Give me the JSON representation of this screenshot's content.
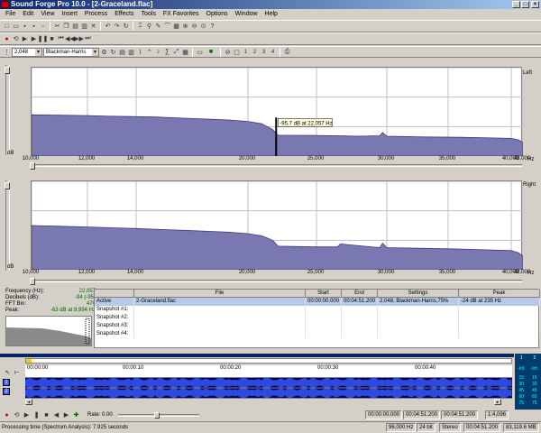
{
  "titlebar": {
    "title": "Sound Forge Pro 10.0 - [2-Graceland.flac]",
    "min": "_",
    "max": "□",
    "close": "×"
  },
  "menu": [
    "File",
    "Edit",
    "View",
    "Insert",
    "Process",
    "Effects",
    "Tools",
    "FX Favorites",
    "Options",
    "Window",
    "Help"
  ],
  "spectrum_toolbar": {
    "fft_size": "2,048",
    "window": "Blackman-Harris",
    "nums": [
      "1",
      "2",
      "3",
      "4"
    ]
  },
  "chart_data": [
    {
      "type": "area",
      "channel": "Left",
      "xlabel": "Hz",
      "ylabel": "dB",
      "x_ticks": [
        "10,000",
        "12,000",
        "14,000",
        "20,000",
        "25,000",
        "30,000",
        "35,000",
        "40,000",
        "48,000"
      ],
      "y_ticks": [
        "-4",
        "-44",
        "-84",
        "-124"
      ],
      "ylim": [
        -124,
        -4
      ],
      "series": [
        {
          "x": [
            10000,
            11000,
            12000,
            13000,
            14000,
            15000,
            16000,
            17000,
            18000,
            19000,
            20000,
            21000,
            21800,
            22200,
            25000,
            28000,
            29500,
            29700,
            30000,
            33000,
            36000,
            40000,
            45000,
            48000
          ],
          "y": [
            -68,
            -68.5,
            -69,
            -70,
            -70.5,
            -71,
            -72,
            -73,
            -74,
            -75,
            -77,
            -80,
            -88,
            -95.7,
            -96,
            -97,
            -96.5,
            -92,
            -97,
            -98,
            -98.5,
            -100,
            -102,
            -106
          ]
        }
      ],
      "annotation": "-95.7 dB at 22,057 Hz"
    },
    {
      "type": "area",
      "channel": "Right",
      "xlabel": "Hz",
      "ylabel": "dB",
      "x_ticks": [
        "10,000",
        "12,000",
        "14,000",
        "20,000",
        "25,000",
        "30,000",
        "35,000",
        "40,000",
        "48,000"
      ],
      "y_ticks": [
        "-4",
        "-44",
        "-84",
        "-124"
      ],
      "ylim": [
        -124,
        -4
      ],
      "series": [
        {
          "x": [
            10000,
            11000,
            12000,
            13000,
            14000,
            15000,
            16000,
            17000,
            18000,
            19000,
            20000,
            21000,
            21800,
            22200,
            25000,
            26500,
            26700,
            29500,
            29700,
            30000,
            33000,
            36000,
            40000,
            45000,
            48000
          ],
          "y": [
            -64,
            -65,
            -66,
            -67,
            -68,
            -69,
            -70,
            -71,
            -72,
            -73,
            -75,
            -78,
            -84,
            -92,
            -93,
            -93,
            -89,
            -94,
            -88,
            -94,
            -95,
            -96,
            -98,
            -101,
            -106
          ]
        }
      ]
    }
  ],
  "stats": [
    {
      "label": "Frequency (Hz):",
      "value": "22,057"
    },
    {
      "label": "Decibels (dB):",
      "value": "-94 (-95)"
    },
    {
      "label": "FFT Bin:",
      "value": "470"
    },
    {
      "label": "Peak:",
      "value": "-63 dB at 9,994 Hz"
    }
  ],
  "table": {
    "headers": [
      "",
      "File",
      "Start",
      "End",
      "Settings",
      "Peak"
    ],
    "rows": [
      [
        "Active",
        "2-Graceland.flac",
        "00:00:00.000",
        "00:04:51.200",
        "2,048, Blackman-Harris,75%",
        "-24 dB at 235 Hz"
      ],
      [
        "Snapshot #1:",
        "",
        "",
        "",
        "",
        ""
      ],
      [
        "Snapshot #2:",
        "",
        "",
        "",
        "",
        ""
      ],
      [
        "Snapshot #3:",
        "",
        "",
        "",
        "",
        ""
      ],
      [
        "Snapshot #4:",
        "",
        "",
        "",
        "",
        ""
      ]
    ]
  },
  "timeline": [
    "00:00:00",
    "00:00:10",
    "00:00:20",
    "00:00:30",
    "00:00:40"
  ],
  "channels": [
    "1",
    "2"
  ],
  "transport": {
    "rate_label": "Rate: 0.00"
  },
  "status": {
    "msg": "Processing time (Spectrum Analysis): 7.925 seconds",
    "sel_start": "00:00:00.000",
    "sel_end": "00:04:51.200",
    "sel_len": "00:04:51.200",
    "zoom": "1:4,096",
    "rate": "96,000 Hz",
    "bits": "24 bit",
    "chan": "Stereo",
    "len": "00:04:51.200",
    "space": "83,119.6 MB"
  },
  "meters": {
    "top": [
      "1",
      "2"
    ],
    "labels": [
      "-Inf.",
      "-Inf."
    ],
    "scale": [
      "15",
      "30",
      "45",
      "60",
      "75"
    ]
  },
  "colors": {
    "spectrum_fill": "#7a78b0",
    "spectrum_stroke": "#3c3a80",
    "wave": "#3a5cff",
    "wave_bg": "#000060"
  }
}
